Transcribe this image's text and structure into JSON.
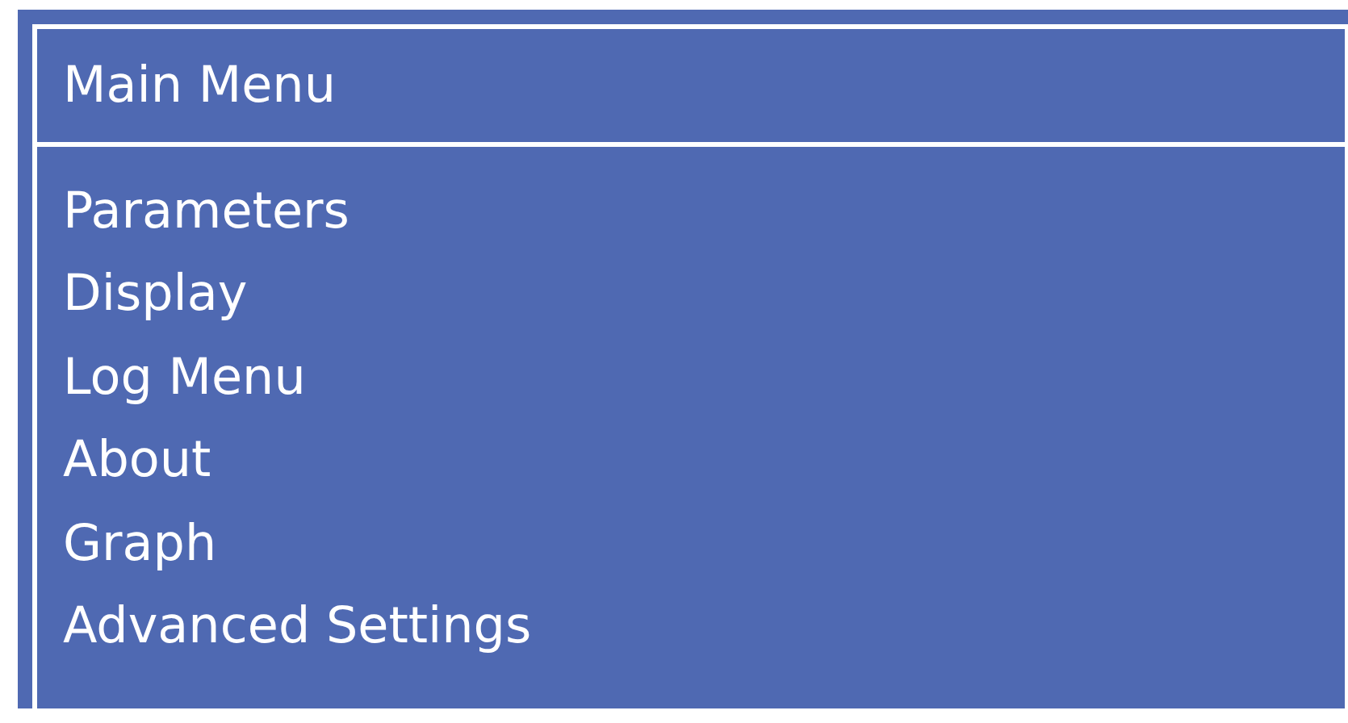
{
  "menu": {
    "title": "Main Menu",
    "items": [
      {
        "label": "Parameters"
      },
      {
        "label": "Display"
      },
      {
        "label": "Log Menu"
      },
      {
        "label": "About"
      },
      {
        "label": "Graph"
      },
      {
        "label": "Advanced Settings"
      }
    ]
  }
}
